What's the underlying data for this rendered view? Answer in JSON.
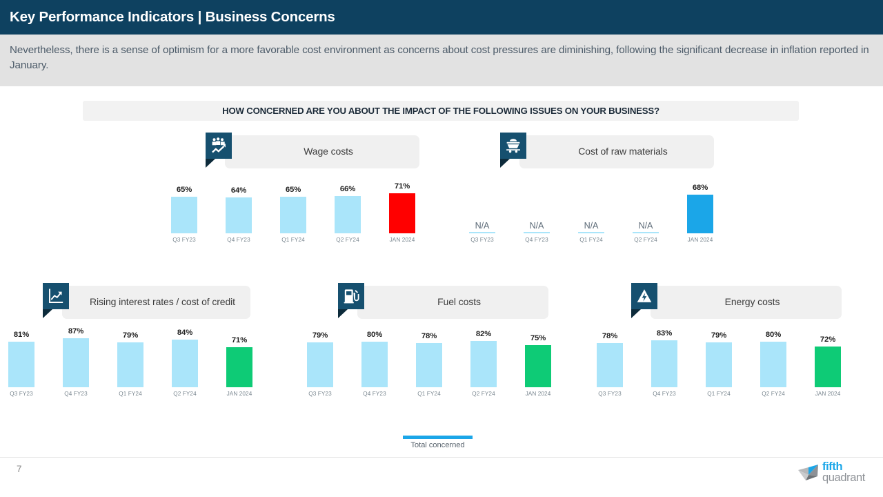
{
  "header": {
    "title": "Key Performance Indicators | Business Concerns",
    "subtitle": "Nevertheless, there is a sense of optimism for a more favorable cost environment as concerns about cost pressures are diminishing, following the significant decrease in inflation reported in January.",
    "bar_color": "#0e4160",
    "subtitle_bg": "#e2e2e2"
  },
  "question": {
    "text": "HOW CONCERNED ARE YOU ABOUT THE IMPACT OF THE FOLLOWING ISSUES ON YOUR BUSINESS?"
  },
  "legend": {
    "label": "Total concerned",
    "color": "#1ba6e8"
  },
  "footer": {
    "page_number": "7",
    "logo_line1": "fifth",
    "logo_line2": "quadrant"
  },
  "colors": {
    "bar_default": "#aae5fa",
    "bar_red": "#ff0000",
    "bar_blue": "#1ba6e8",
    "bar_green": "#0ecb76",
    "icon_tile": "#16506f",
    "panel_plate": "#f0f0f0"
  },
  "chart_data": [
    {
      "type": "bar",
      "title": "Wage costs",
      "icon": "wage-growth-icon",
      "categories": [
        "Q3 FY23",
        "Q4 FY23",
        "Q1 FY24",
        "Q2 FY24",
        "JAN 2024"
      ],
      "values": [
        65,
        64,
        65,
        66,
        71
      ],
      "labels": [
        "65%",
        "64%",
        "65%",
        "66%",
        "71%"
      ],
      "bar_colors": [
        "#aae5fa",
        "#aae5fa",
        "#aae5fa",
        "#aae5fa",
        "#ff0000"
      ],
      "xlabel": "",
      "ylabel": "",
      "ylim": [
        0,
        100
      ],
      "grid": false,
      "legend_position": "bottom-center"
    },
    {
      "type": "bar",
      "title": "Cost of raw materials",
      "icon": "mining-cart-icon",
      "categories": [
        "Q3 FY23",
        "Q4 FY23",
        "Q1 FY24",
        "Q2 FY24",
        "JAN 2024"
      ],
      "values": [
        null,
        null,
        null,
        null,
        68
      ],
      "labels": [
        "N/A",
        "N/A",
        "N/A",
        "N/A",
        "68%"
      ],
      "bar_colors": [
        "#aae5fa",
        "#aae5fa",
        "#aae5fa",
        "#aae5fa",
        "#1ba6e8"
      ],
      "xlabel": "",
      "ylabel": "",
      "ylim": [
        0,
        100
      ],
      "grid": false,
      "legend_position": "bottom-center"
    },
    {
      "type": "bar",
      "title": "Rising interest rates / cost of credit",
      "icon": "line-chart-icon",
      "categories": [
        "Q3 FY23",
        "Q4 FY23",
        "Q1 FY24",
        "Q2 FY24",
        "JAN 2024"
      ],
      "values": [
        81,
        87,
        79,
        84,
        71
      ],
      "labels": [
        "81%",
        "87%",
        "79%",
        "84%",
        "71%"
      ],
      "bar_colors": [
        "#aae5fa",
        "#aae5fa",
        "#aae5fa",
        "#aae5fa",
        "#0ecb76"
      ],
      "xlabel": "",
      "ylabel": "",
      "ylim": [
        0,
        100
      ],
      "grid": false,
      "legend_position": "bottom-center"
    },
    {
      "type": "bar",
      "title": "Fuel costs",
      "icon": "fuel-pump-icon",
      "categories": [
        "Q3 FY23",
        "Q4 FY23",
        "Q1 FY24",
        "Q2 FY24",
        "JAN 2024"
      ],
      "values": [
        79,
        80,
        78,
        82,
        75
      ],
      "labels": [
        "79%",
        "80%",
        "78%",
        "82%",
        "75%"
      ],
      "bar_colors": [
        "#aae5fa",
        "#aae5fa",
        "#aae5fa",
        "#aae5fa",
        "#0ecb76"
      ],
      "xlabel": "",
      "ylabel": "",
      "ylim": [
        0,
        100
      ],
      "grid": false,
      "legend_position": "bottom-center"
    },
    {
      "type": "bar",
      "title": "Energy costs",
      "icon": "energy-hazard-icon",
      "categories": [
        "Q3 FY23",
        "Q4 FY23",
        "Q1 FY24",
        "Q2 FY24",
        "JAN 2024"
      ],
      "values": [
        78,
        83,
        79,
        80,
        72
      ],
      "labels": [
        "78%",
        "83%",
        "79%",
        "80%",
        "72%"
      ],
      "bar_colors": [
        "#aae5fa",
        "#aae5fa",
        "#aae5fa",
        "#aae5fa",
        "#0ecb76"
      ],
      "xlabel": "",
      "ylabel": "",
      "ylim": [
        0,
        100
      ],
      "grid": false,
      "legend_position": "bottom-center"
    }
  ]
}
